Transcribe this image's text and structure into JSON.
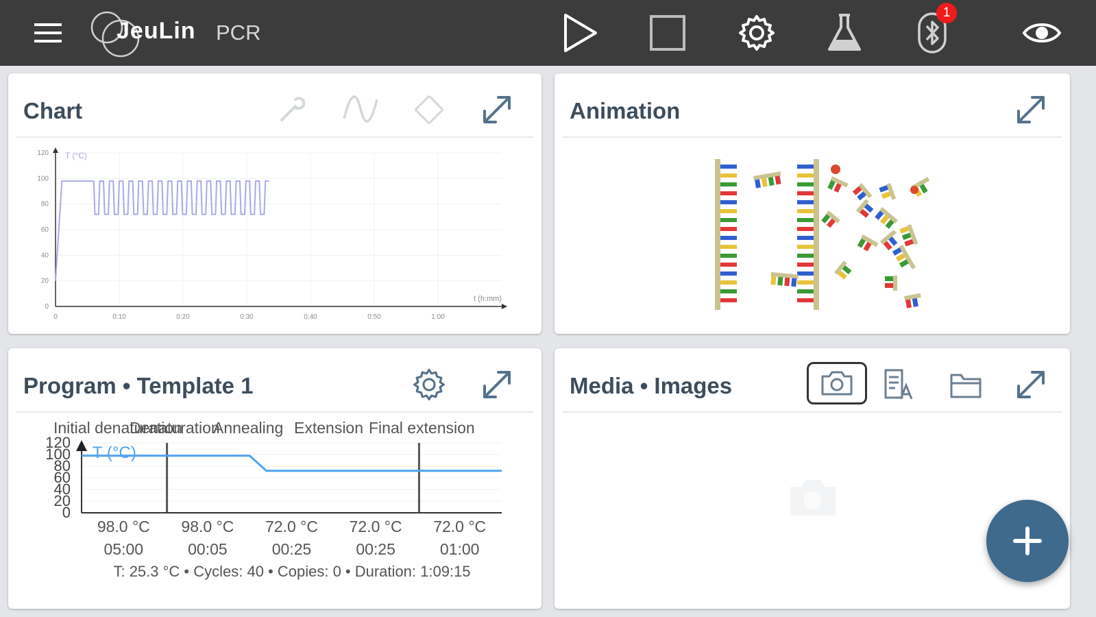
{
  "app": {
    "brand": "JeuLin",
    "product": "PCR",
    "bluetooth_badge": "1"
  },
  "panels": {
    "chart": {
      "title": "Chart"
    },
    "animation": {
      "title": "Animation"
    },
    "program": {
      "title": "Program • Template 1"
    },
    "media": {
      "title": "Media • Images"
    }
  },
  "chart_data": [
    {
      "type": "line",
      "title": "",
      "ylabel": "T (°C)",
      "xlabel": "t (h:mm)",
      "ylim": [
        0,
        120
      ],
      "yticks": [
        "0",
        "20",
        "40",
        "60",
        "80",
        "100",
        "120"
      ],
      "xticks": [
        "0",
        "0:10",
        "0:20",
        "0:30",
        "0:40",
        "0:50",
        "1:00"
      ],
      "series": [
        {
          "name": "T (°C)",
          "color": "#a9a9e8",
          "profile": {
            "start_temp": 20,
            "ramp_end_minutes": 1,
            "initial_hold_temp": 98,
            "initial_hold_end_minutes": 6,
            "cycles": 18,
            "cycle_high": 98,
            "cycle_low": 72,
            "cycles_end_minutes": 33.5
          }
        }
      ]
    },
    {
      "type": "line",
      "title": "",
      "ylabel": "T (°C)",
      "ylim": [
        0,
        120
      ],
      "yticks": [
        "0",
        "20",
        "40",
        "60",
        "80",
        "100",
        "120"
      ],
      "stages": [
        {
          "name": "Initial denaturation",
          "temp": "98.0 °C",
          "time": "05:00"
        },
        {
          "name": "Denaturation",
          "temp": "98.0 °C",
          "time": "00:05"
        },
        {
          "name": "Annealing",
          "temp": "72.0 °C",
          "time": "00:25"
        },
        {
          "name": "Extension",
          "temp": "72.0 °C",
          "time": "00:25"
        },
        {
          "name": "Final extension",
          "temp": "72.0 °C",
          "time": "01:00"
        }
      ],
      "series": [
        {
          "name": "T (°C)",
          "color": "#4da3f0",
          "points": [
            [
              0,
              98
            ],
            [
              2,
              98
            ],
            [
              2.2,
              72
            ],
            [
              5,
              72
            ]
          ]
        }
      ],
      "status": "T: 25.3 °C • Cycles: 40 • Copies: 0 • Duration: 1:09:15"
    }
  ],
  "colors": {
    "topbar": "#3c3c3c",
    "fab": "#3e6a8e",
    "panel_title": "#3d4d5c",
    "icon_gray": "#6c7f90",
    "badge": "#ee1c1c"
  },
  "icons": {
    "menu": "hamburger-icon",
    "play": "play-icon",
    "stop": "stop-icon",
    "settings": "gear-icon",
    "experiment": "flask-icon",
    "bluetooth": "bluetooth-icon",
    "view": "eye-icon"
  }
}
